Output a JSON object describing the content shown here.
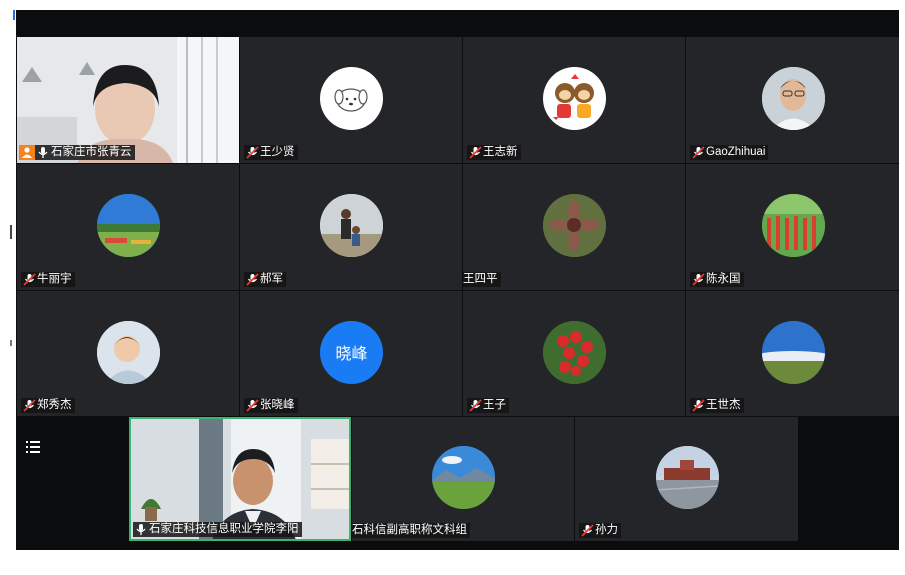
{
  "window": {
    "title": ""
  },
  "participants": [
    {
      "name": "石家庄市张青云",
      "avatar": "video-camera-feed",
      "mic": "on",
      "host_badge": true
    },
    {
      "name": "王少贤",
      "avatar": "white-puppy-avatar",
      "mic": "muted"
    },
    {
      "name": "王志新",
      "avatar": "cartoon-monkeys-avatar",
      "mic": "muted"
    },
    {
      "name": "GaoZhihuai",
      "avatar": "man-portrait-avatar",
      "mic": "muted"
    },
    {
      "name": "牛丽宇",
      "avatar": "park-landscape-avatar",
      "mic": "muted"
    },
    {
      "name": "郝军",
      "avatar": "two-people-photo-avatar",
      "mic": "muted"
    },
    {
      "name": "王四平",
      "avatar": "flower-closeup-avatar",
      "mic": "none"
    },
    {
      "name": "陈永国",
      "avatar": "red-flower-field-avatar",
      "mic": "muted"
    },
    {
      "name": "郑秀杰",
      "avatar": "baby-photo-avatar",
      "mic": "muted"
    },
    {
      "name": "张晓峰",
      "avatar": "text-avatar",
      "avatar_text": "晓峰",
      "mic": "muted"
    },
    {
      "name": "王子",
      "avatar": "red-berries-avatar",
      "mic": "muted"
    },
    {
      "name": "王世杰",
      "avatar": "blue-sky-avatar",
      "mic": "muted"
    },
    {
      "name": "石家庄科技信息职业学院李阳",
      "avatar": "video-camera-feed",
      "mic": "on",
      "active_speaker": true
    },
    {
      "name": "石科信副高职称文科组",
      "avatar": "green-meadow-avatar",
      "mic": "none"
    },
    {
      "name": "孙力",
      "avatar": "city-square-avatar",
      "mic": "muted"
    }
  ],
  "controls": {
    "list_icon": "list-menu-icon"
  },
  "colors": {
    "tile_bg": "#242528",
    "app_bg": "#0b0c0e",
    "speaker_border": "#3cb371",
    "avatar_blue": "#1a7cf5",
    "host_badge": "#f5821f"
  }
}
